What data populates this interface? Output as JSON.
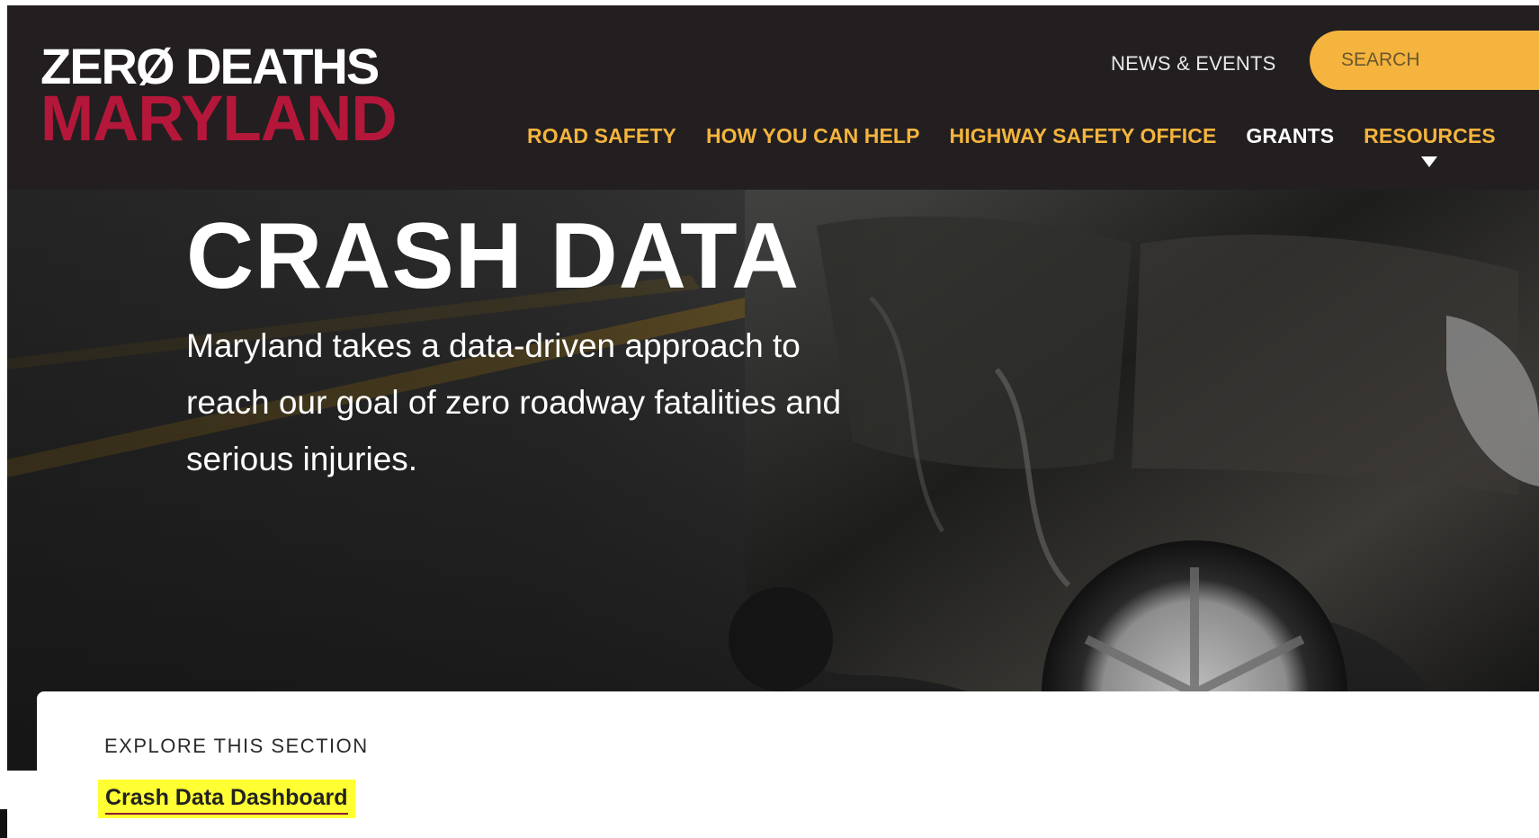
{
  "logo": {
    "line1": "ZERØ DEATHS",
    "line2": "MARYLAND"
  },
  "header": {
    "util_link": "NEWS & EVENTS",
    "search_placeholder": "SEARCH"
  },
  "nav": {
    "items": [
      {
        "label": "ROAD SAFETY"
      },
      {
        "label": "HOW YOU CAN HELP"
      },
      {
        "label": "HIGHWAY SAFETY OFFICE"
      },
      {
        "label": "GRANTS"
      },
      {
        "label": "RESOURCES"
      }
    ]
  },
  "hero": {
    "title": "CRASH DATA",
    "subtitle": "Maryland takes a data-driven approach to reach our goal of zero roadway fatalities and serious injuries."
  },
  "explore": {
    "heading": "EXPLORE THIS SECTION",
    "link": "Crash Data Dashboard"
  },
  "colors": {
    "header_bg": "#231f20",
    "accent_gold": "#f4b43d",
    "brand_red": "#b5173a",
    "highlight": "#ffff33"
  },
  "icons": {
    "dropdown": "caret-down-icon"
  }
}
